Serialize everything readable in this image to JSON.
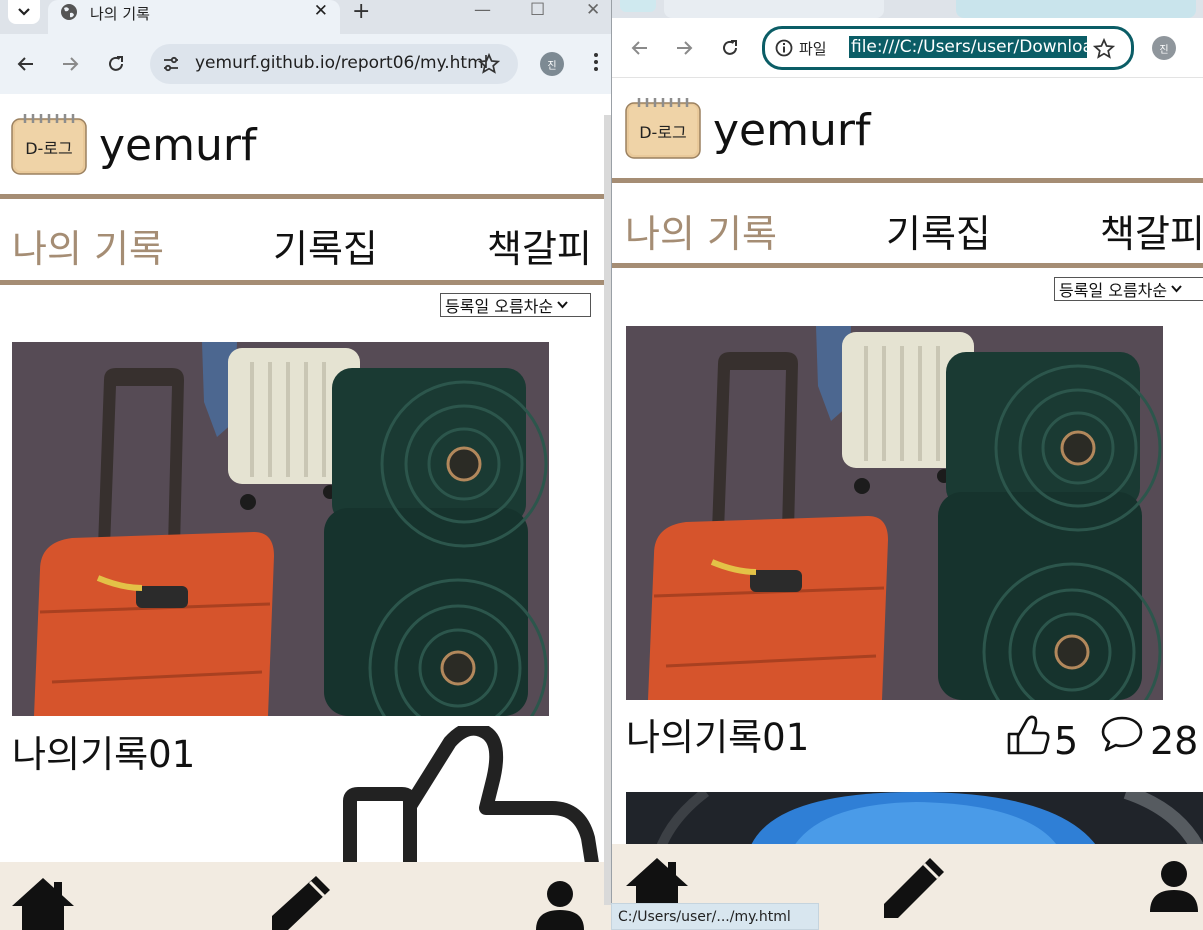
{
  "left_window": {
    "tab_title": "나의 기록",
    "url": "yemurf.github.io/report06/my.html",
    "avatar_letter": "진"
  },
  "right_window": {
    "site_info_label": "파일",
    "url": "file:///C:/Users/user/Downloac",
    "avatar_letter": "진",
    "status_url": "C:/Users/user/.../my.html"
  },
  "site": {
    "name": "yemurf",
    "logo_text": "D-로그",
    "nav": [
      "나의 기록",
      "기록집",
      "책갈피"
    ],
    "active_nav": "나의 기록",
    "sort_option": "등록일 오름차순",
    "post_title": "나의기록01",
    "likes": "5",
    "comments": "28"
  },
  "colors": {
    "accent_brown": "#a58d74",
    "footer_beige": "#f2ebe1",
    "focus_teal": "#0b5d66"
  },
  "icons": {
    "footer": [
      "home-icon",
      "pencil-icon",
      "user-icon"
    ],
    "stats": [
      "thumbs-up-icon",
      "comment-icon"
    ]
  }
}
